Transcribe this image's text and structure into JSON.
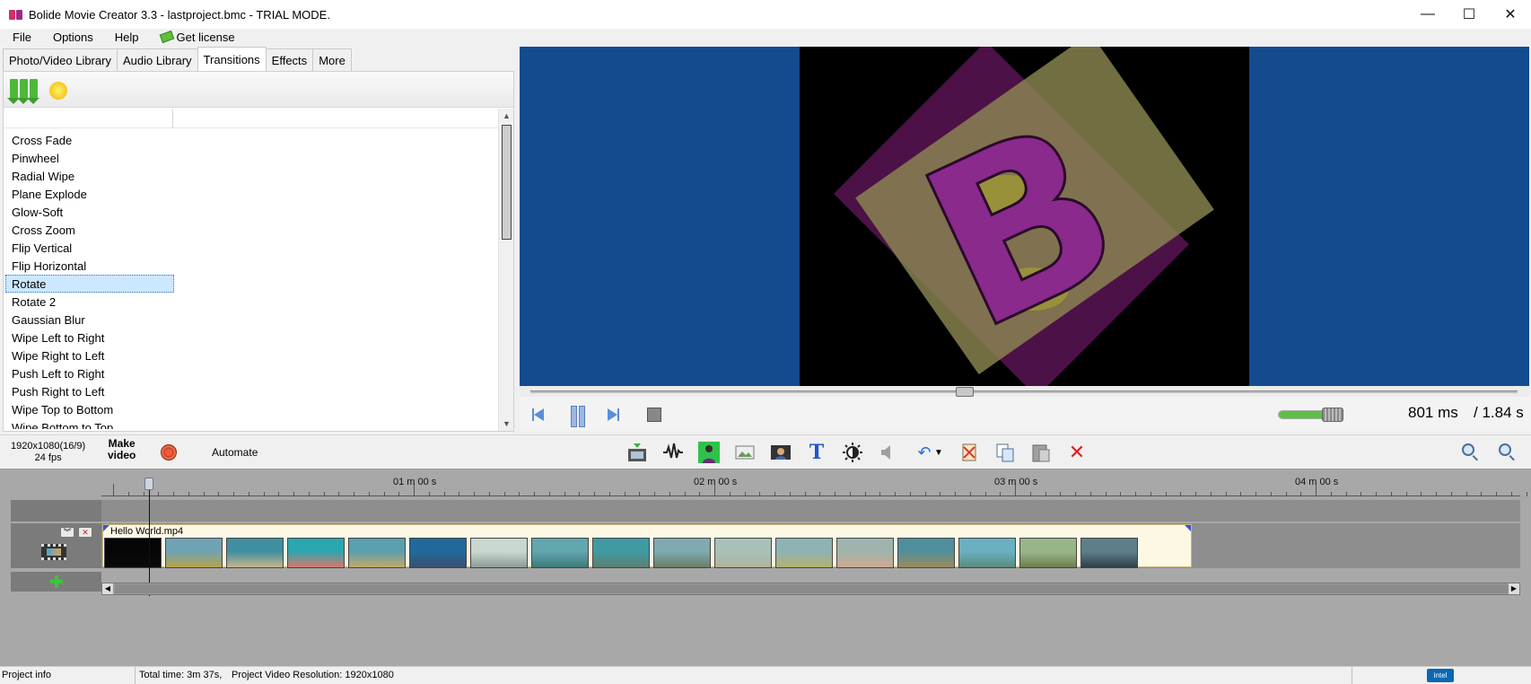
{
  "window": {
    "title": "Bolide Movie Creator 3.3 - lastproject.bmc  - TRIAL MODE.",
    "minimize": "—",
    "maximize": "☐",
    "close": "✕"
  },
  "menu": {
    "items": [
      "File",
      "Options",
      "Help"
    ],
    "license": "Get license"
  },
  "tabs": [
    {
      "label": "Photo/Video Library",
      "active": false
    },
    {
      "label": "Audio Library",
      "active": false
    },
    {
      "label": "Transitions",
      "active": true
    },
    {
      "label": "Effects",
      "active": false
    },
    {
      "label": "More",
      "active": false
    }
  ],
  "transitions": {
    "items": [
      "Cross Fade",
      "Pinwheel",
      "Radial Wipe",
      "Plane Explode",
      "Glow-Soft",
      "Cross Zoom",
      "Flip Vertical",
      "Flip Horizontal",
      "Rotate",
      "Rotate 2",
      "Gaussian Blur",
      "Wipe Left to Right",
      "Wipe Right to Left",
      "Push Left to Right",
      "Push Right to Left",
      "Wipe Top to Bottom",
      "Wipe Bottom to Top"
    ],
    "selected": "Rotate"
  },
  "player": {
    "current_time": "801 ms",
    "total_time": "/ 1.84 s",
    "seek_fraction": 0.44,
    "volume_fraction": 0.75,
    "preview_letter": "B"
  },
  "toolbar": {
    "resolution": "1920x1080(16/9)",
    "fps": "24 fps",
    "make_video_line1": "Make",
    "make_video_line2": "video",
    "automate": "Automate",
    "icons": [
      "add-video-icon",
      "audio-wave-icon",
      "person-green-icon",
      "image-icon",
      "portrait-icon",
      "text-icon",
      "brightness-icon",
      "speaker-icon",
      "undo-icon",
      "cut-icon",
      "copy-icon",
      "paste-icon",
      "delete-icon"
    ]
  },
  "timeline": {
    "ruler_labels": [
      "01 m 00 s",
      "02 m 00 s",
      "03 m 00 s",
      "04 m 00 s"
    ],
    "clip_name": "Hello World.mp4",
    "thumb_colors": [
      [
        "#050505",
        "#0a0a0a"
      ],
      [
        "#6fa3b4",
        "#b7a34a"
      ],
      [
        "#3f8fa0",
        "#c9b58a"
      ],
      [
        "#2aa6b0",
        "#d9786a"
      ],
      [
        "#5a9fae",
        "#c4a867"
      ],
      [
        "#1f6a9a",
        "#3a4f6e"
      ],
      [
        "#c9d7cf",
        "#8c9c96"
      ],
      [
        "#62a6ae",
        "#3e7a7a"
      ],
      [
        "#3f9aa2",
        "#5c7f72"
      ],
      [
        "#7eaab0",
        "#6b7d65"
      ],
      [
        "#a8c1b8",
        "#b1b39a"
      ],
      [
        "#8eb3b5",
        "#b4b26f"
      ],
      [
        "#9fb4ad",
        "#cfa88e"
      ],
      [
        "#4f8f9b",
        "#9d8a5a"
      ],
      [
        "#6ab0c0",
        "#5a8a7e"
      ],
      [
        "#98b58a",
        "#6e7f4c"
      ],
      [
        "#5d7f8a",
        "#2e3f48"
      ]
    ]
  },
  "status": {
    "project_info": "Project info",
    "total_time": "Total time: 3m 37s,",
    "resolution": "Project Video Resolution:   1920x1080",
    "intel": "intel"
  },
  "colors": {
    "preview_bg": "#134b8e",
    "timeline_bg": "#a8a8a8",
    "clip_bg": "#fdf8e4",
    "selection": "#cce8ff"
  }
}
